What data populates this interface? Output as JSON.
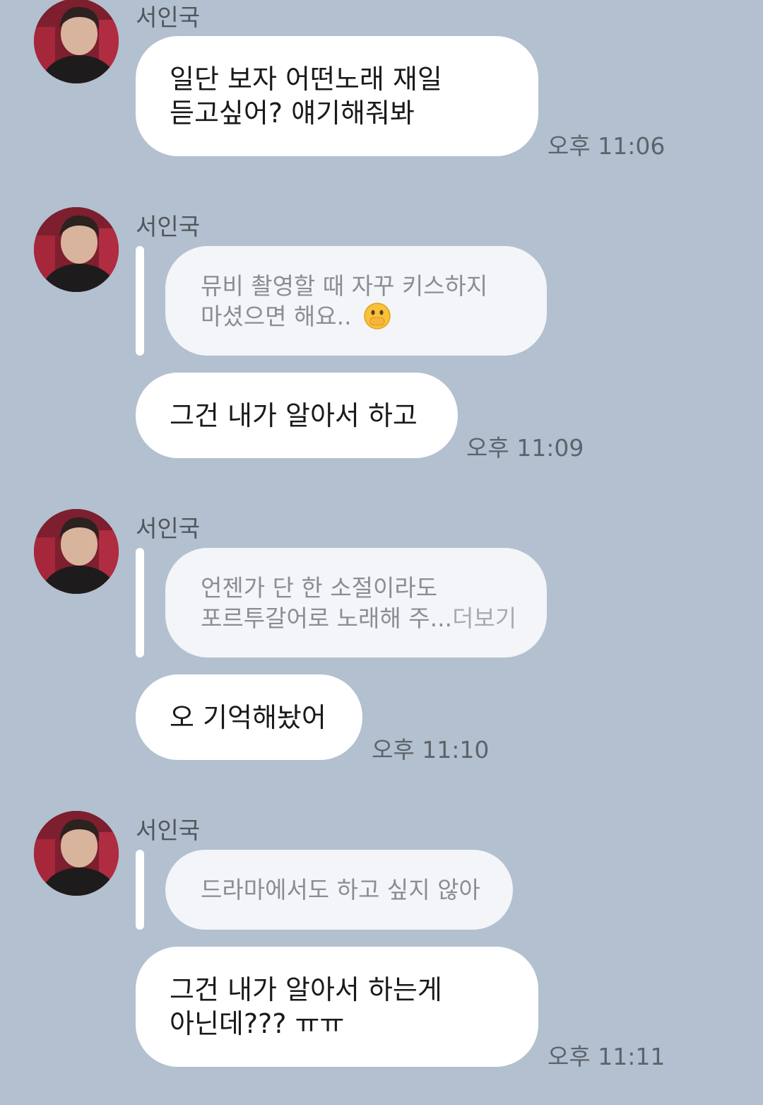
{
  "messages": [
    {
      "sender": "서인국",
      "reply_to": null,
      "lines": [
        "일단 보자 어떤노래 재일",
        "듣고싶어? 얘기해줘봐"
      ],
      "time": "오후 11:06"
    },
    {
      "sender": "서인국",
      "reply_to": {
        "lines": [
          "뮤비 촬영할 때 자꾸 키스하지",
          "마셨으면 해요.."
        ],
        "emoji": "face-with-hand-over-mouth-emoji"
      },
      "lines": [
        "그건 내가 알아서 하고"
      ],
      "time": "오후 11:09"
    },
    {
      "sender": "서인국",
      "reply_to": {
        "lines": [
          "언젠가 단 한 소절이라도",
          "포르투갈어로 노래해 주..."
        ],
        "more": "더보기"
      },
      "lines": [
        "오 기억해놨어"
      ],
      "time": "오후 11:10"
    },
    {
      "sender": "서인국",
      "reply_to": {
        "lines": [
          "드라마에서도 하고 싶지 않아"
        ]
      },
      "lines": [
        "그건 내가 알아서 하는게",
        "아닌데??? ㅠㅠ"
      ],
      "time": "오후 11:11"
    }
  ],
  "colors": {
    "background": "#b2c0d0",
    "bubble": "#ffffff",
    "quote": "#f4f5f8",
    "quote_text": "#8a8d92",
    "time_text": "#5d636a"
  }
}
